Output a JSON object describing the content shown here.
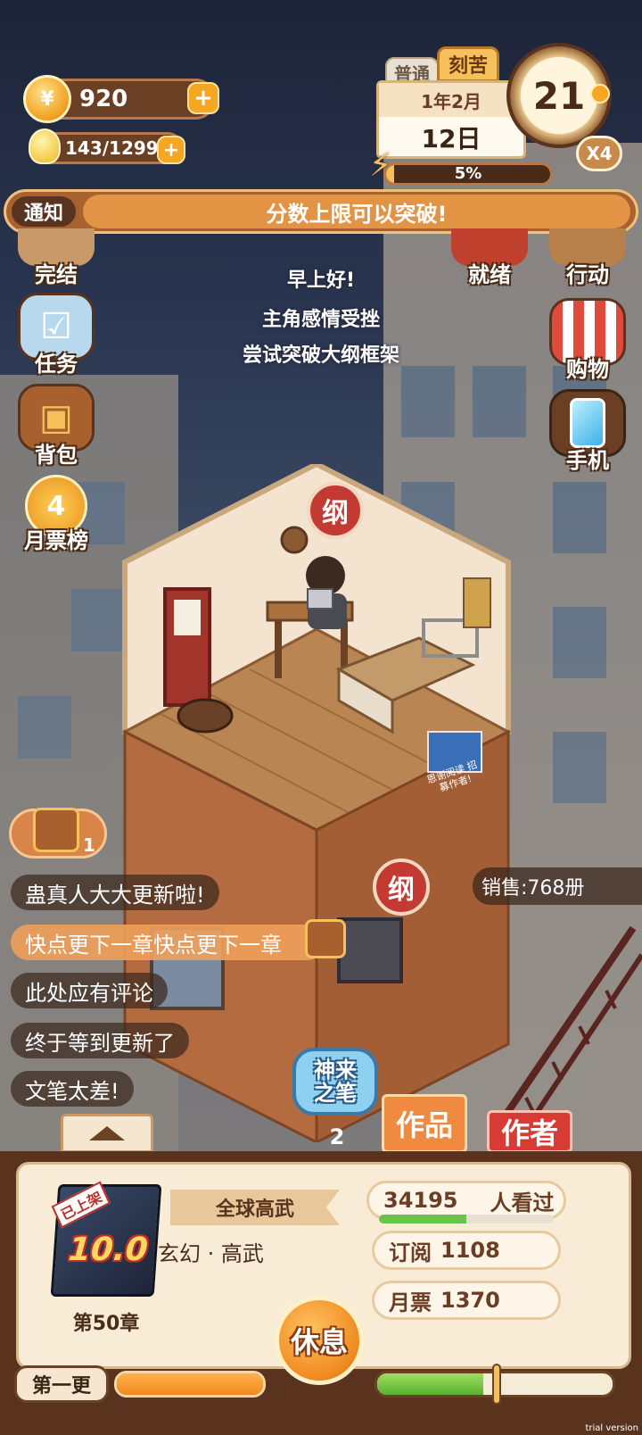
{
  "resources": {
    "coins": "920",
    "energy": "143/1299"
  },
  "calendar": {
    "mode_normal": "普通",
    "mode_hard": "刻苦",
    "year_month": "1年2月",
    "day": "12日",
    "progress_text": "5%",
    "progress": 0.05,
    "clock_number": "21",
    "speed": "X4"
  },
  "notice": {
    "tag": "通知",
    "text": "分数上限可以突破!"
  },
  "greeting": {
    "line1": "早上好!",
    "line2": "主角感情受挫",
    "line3": "尝试突破大纲框架"
  },
  "left_menu": [
    {
      "label": "完结",
      "icon": "book-icon"
    },
    {
      "label": "任务",
      "icon": "checklist-icon"
    },
    {
      "label": "背包",
      "icon": "backpack-icon"
    },
    {
      "label": "月票榜",
      "icon": "ticket-coin-icon"
    }
  ],
  "right_menu": [
    {
      "label": "就绪",
      "icon": "ready-icon"
    },
    {
      "label": "行动",
      "icon": "door-icon"
    },
    {
      "label": "购物",
      "icon": "shop-icon"
    },
    {
      "label": "手机",
      "icon": "phone-icon"
    }
  ],
  "room": {
    "sign1": "纲",
    "sign2": "纲",
    "poster": "恩谢阅读 招募作者!"
  },
  "chest_count": "1",
  "sales": "销售:768册",
  "messages": [
    "蛊真人大大更新啦!",
    "快点更下一章快点更下一章",
    "此处应有评论",
    "终于等到更新了",
    "文笔太差!"
  ],
  "magic_pen": {
    "label": "神来之笔",
    "count": "2"
  },
  "tabs": {
    "works": "作品",
    "author": "作者"
  },
  "book": {
    "badge": "已上架",
    "score": "10.0",
    "title": "全球高武",
    "genre": "玄幻 · 高武",
    "chapter": "第50章",
    "viewers": "34195",
    "viewers_label": "人看过",
    "viewers_bar": 0.5,
    "subscribe_label": "订阅",
    "subscribe": "1108",
    "monthly_label": "月票",
    "monthly": "1370"
  },
  "bottom": {
    "update_label": "第一更",
    "rest_label": "休息",
    "left_bar": 1.0,
    "right_bar": 0.45
  },
  "watermark": "trial version"
}
